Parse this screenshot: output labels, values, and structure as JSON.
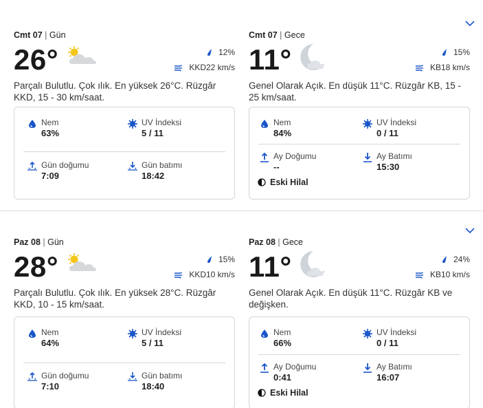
{
  "days": [
    {
      "day": {
        "date": "Cmt 07",
        "sep": " | ",
        "period": "Gün",
        "temp": "26°",
        "icon": "partly-cloudy-sun-icon",
        "precip": "12%",
        "wind": "KKD22 km/s",
        "desc": "Parçalı Bulutlu. Çok ılık. En yüksek 26°C. Rüzgâr KKD, 15 - 30 km/saat.",
        "humidity_label": "Nem",
        "humidity": "63%",
        "uv_label": "UV İndeksi",
        "uv": "5 / 11",
        "rise_label": "Gün doğumu",
        "rise": "7:09",
        "set_label": "Gün batımı",
        "set": "18:42"
      },
      "night": {
        "date": "Cmt 07",
        "sep": " | ",
        "period": "Gece",
        "temp": "11°",
        "icon": "crescent-moon-icon",
        "precip": "15%",
        "wind": "KB18 km/s",
        "desc": "Genel Olarak Açık. En düşük 11°C. Rüzgâr KB, 15 - 25 km/saat.",
        "humidity_label": "Nem",
        "humidity": "84%",
        "uv_label": "UV İndeksi",
        "uv": "0 / 11",
        "rise_label": "Ay Doğumu",
        "rise": "--",
        "set_label": "Ay Batımı",
        "set": "15:30",
        "moon_phase": "Eski Hilal"
      }
    },
    {
      "day": {
        "date": "Paz 08",
        "sep": " | ",
        "period": "Gün",
        "temp": "28°",
        "icon": "partly-cloudy-sun-icon",
        "precip": "15%",
        "wind": "KKD10 km/s",
        "desc": "Parçalı Bulutlu. Çok ılık. En yüksek 28°C. Rüzgâr KKD, 10 - 15 km/saat.",
        "humidity_label": "Nem",
        "humidity": "64%",
        "uv_label": "UV İndeksi",
        "uv": "5 / 11",
        "rise_label": "Gün doğumu",
        "rise": "7:10",
        "set_label": "Gün batımı",
        "set": "18:40"
      },
      "night": {
        "date": "Paz 08",
        "sep": " | ",
        "period": "Gece",
        "temp": "11°",
        "icon": "crescent-moon-icon",
        "precip": "24%",
        "wind": "KB10 km/s",
        "desc": "Genel Olarak Açık. En düşük 11°C. Rüzgâr KB ve değişken.",
        "humidity_label": "Nem",
        "humidity": "66%",
        "uv_label": "UV İndeksi",
        "uv": "0 / 11",
        "rise_label": "Ay Doğumu",
        "rise": "0:41",
        "set_label": "Ay Batımı",
        "set": "16:07",
        "moon_phase": "Eski Hilal"
      }
    }
  ],
  "colors": {
    "accent": "#1a56c9",
    "sun": "#f5c518",
    "cloud": "#d6d8dc",
    "moon": "#cfd3da"
  }
}
